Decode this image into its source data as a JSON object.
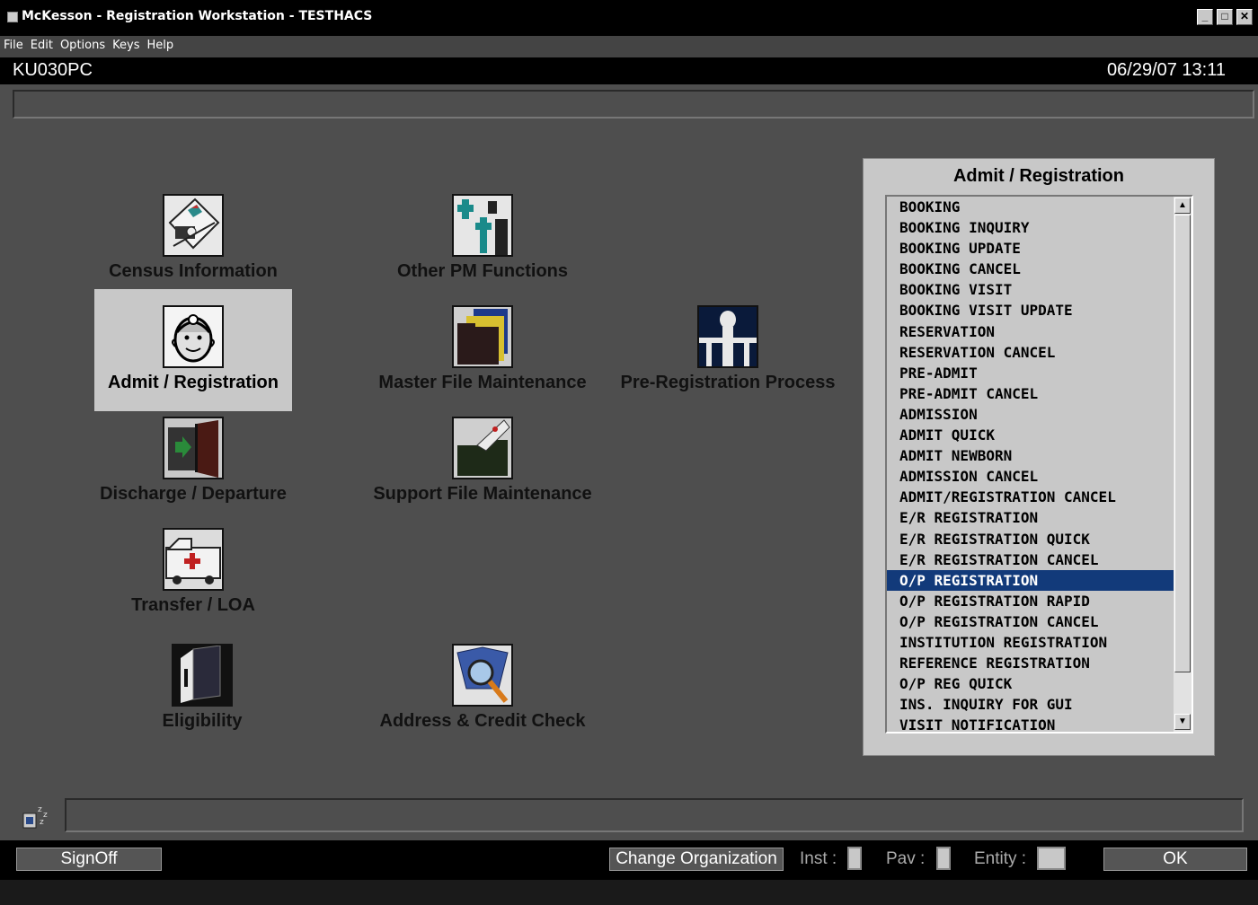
{
  "window": {
    "title": "McKesson - Registration Workstation - TESTHACS",
    "minimize": "_",
    "maximize": "□",
    "close": "✕"
  },
  "menu": [
    "File",
    "Edit",
    "Options",
    "Keys",
    "Help"
  ],
  "header": {
    "screen_id": "KU030PC",
    "datetime": "06/29/07  13:11"
  },
  "tiles": {
    "census": "Census Information",
    "other_pm": "Other PM Functions",
    "admit": "Admit / Registration",
    "master_file": "Master File Maintenance",
    "pre_registration": "Pre-Registration Process",
    "discharge": "Discharge / Departure",
    "support_file": "Support File Maintenance",
    "transfer": "Transfer / LOA",
    "eligibility": "Eligibility",
    "address_credit": "Address & Credit Check"
  },
  "panel": {
    "title": "Admit / Registration",
    "items": [
      "BOOKING",
      "BOOKING INQUIRY",
      "BOOKING UPDATE",
      "BOOKING CANCEL",
      "BOOKING VISIT",
      "BOOKING VISIT UPDATE",
      "RESERVATION",
      "RESERVATION CANCEL",
      "PRE-ADMIT",
      "PRE-ADMIT CANCEL",
      "ADMISSION",
      "ADMIT QUICK",
      "ADMIT NEWBORN",
      "ADMISSION CANCEL",
      "ADMIT/REGISTRATION CANCEL",
      "E/R REGISTRATION",
      "E/R REGISTRATION QUICK",
      "E/R REGISTRATION CANCEL",
      "O/P REGISTRATION",
      "O/P REGISTRATION RAPID",
      "O/P REGISTRATION CANCEL",
      "INSTITUTION REGISTRATION",
      "REFERENCE REGISTRATION",
      "O/P REG QUICK",
      "INS. INQUIRY FOR GUI",
      "VISIT NOTIFICATION"
    ],
    "selected_item": "O/P REGISTRATION",
    "scroll_up": "▲",
    "scroll_down": "▼"
  },
  "footer": {
    "signoff": "SignOff",
    "change_org": "Change Organization",
    "inst_label": "Inst :",
    "pav_label": "Pav :",
    "entity_label": "Entity :",
    "ok": "OK"
  },
  "colors": {
    "background": "#4e4e4e",
    "selection": "#123a7a",
    "panel": "#c8c8c8"
  }
}
